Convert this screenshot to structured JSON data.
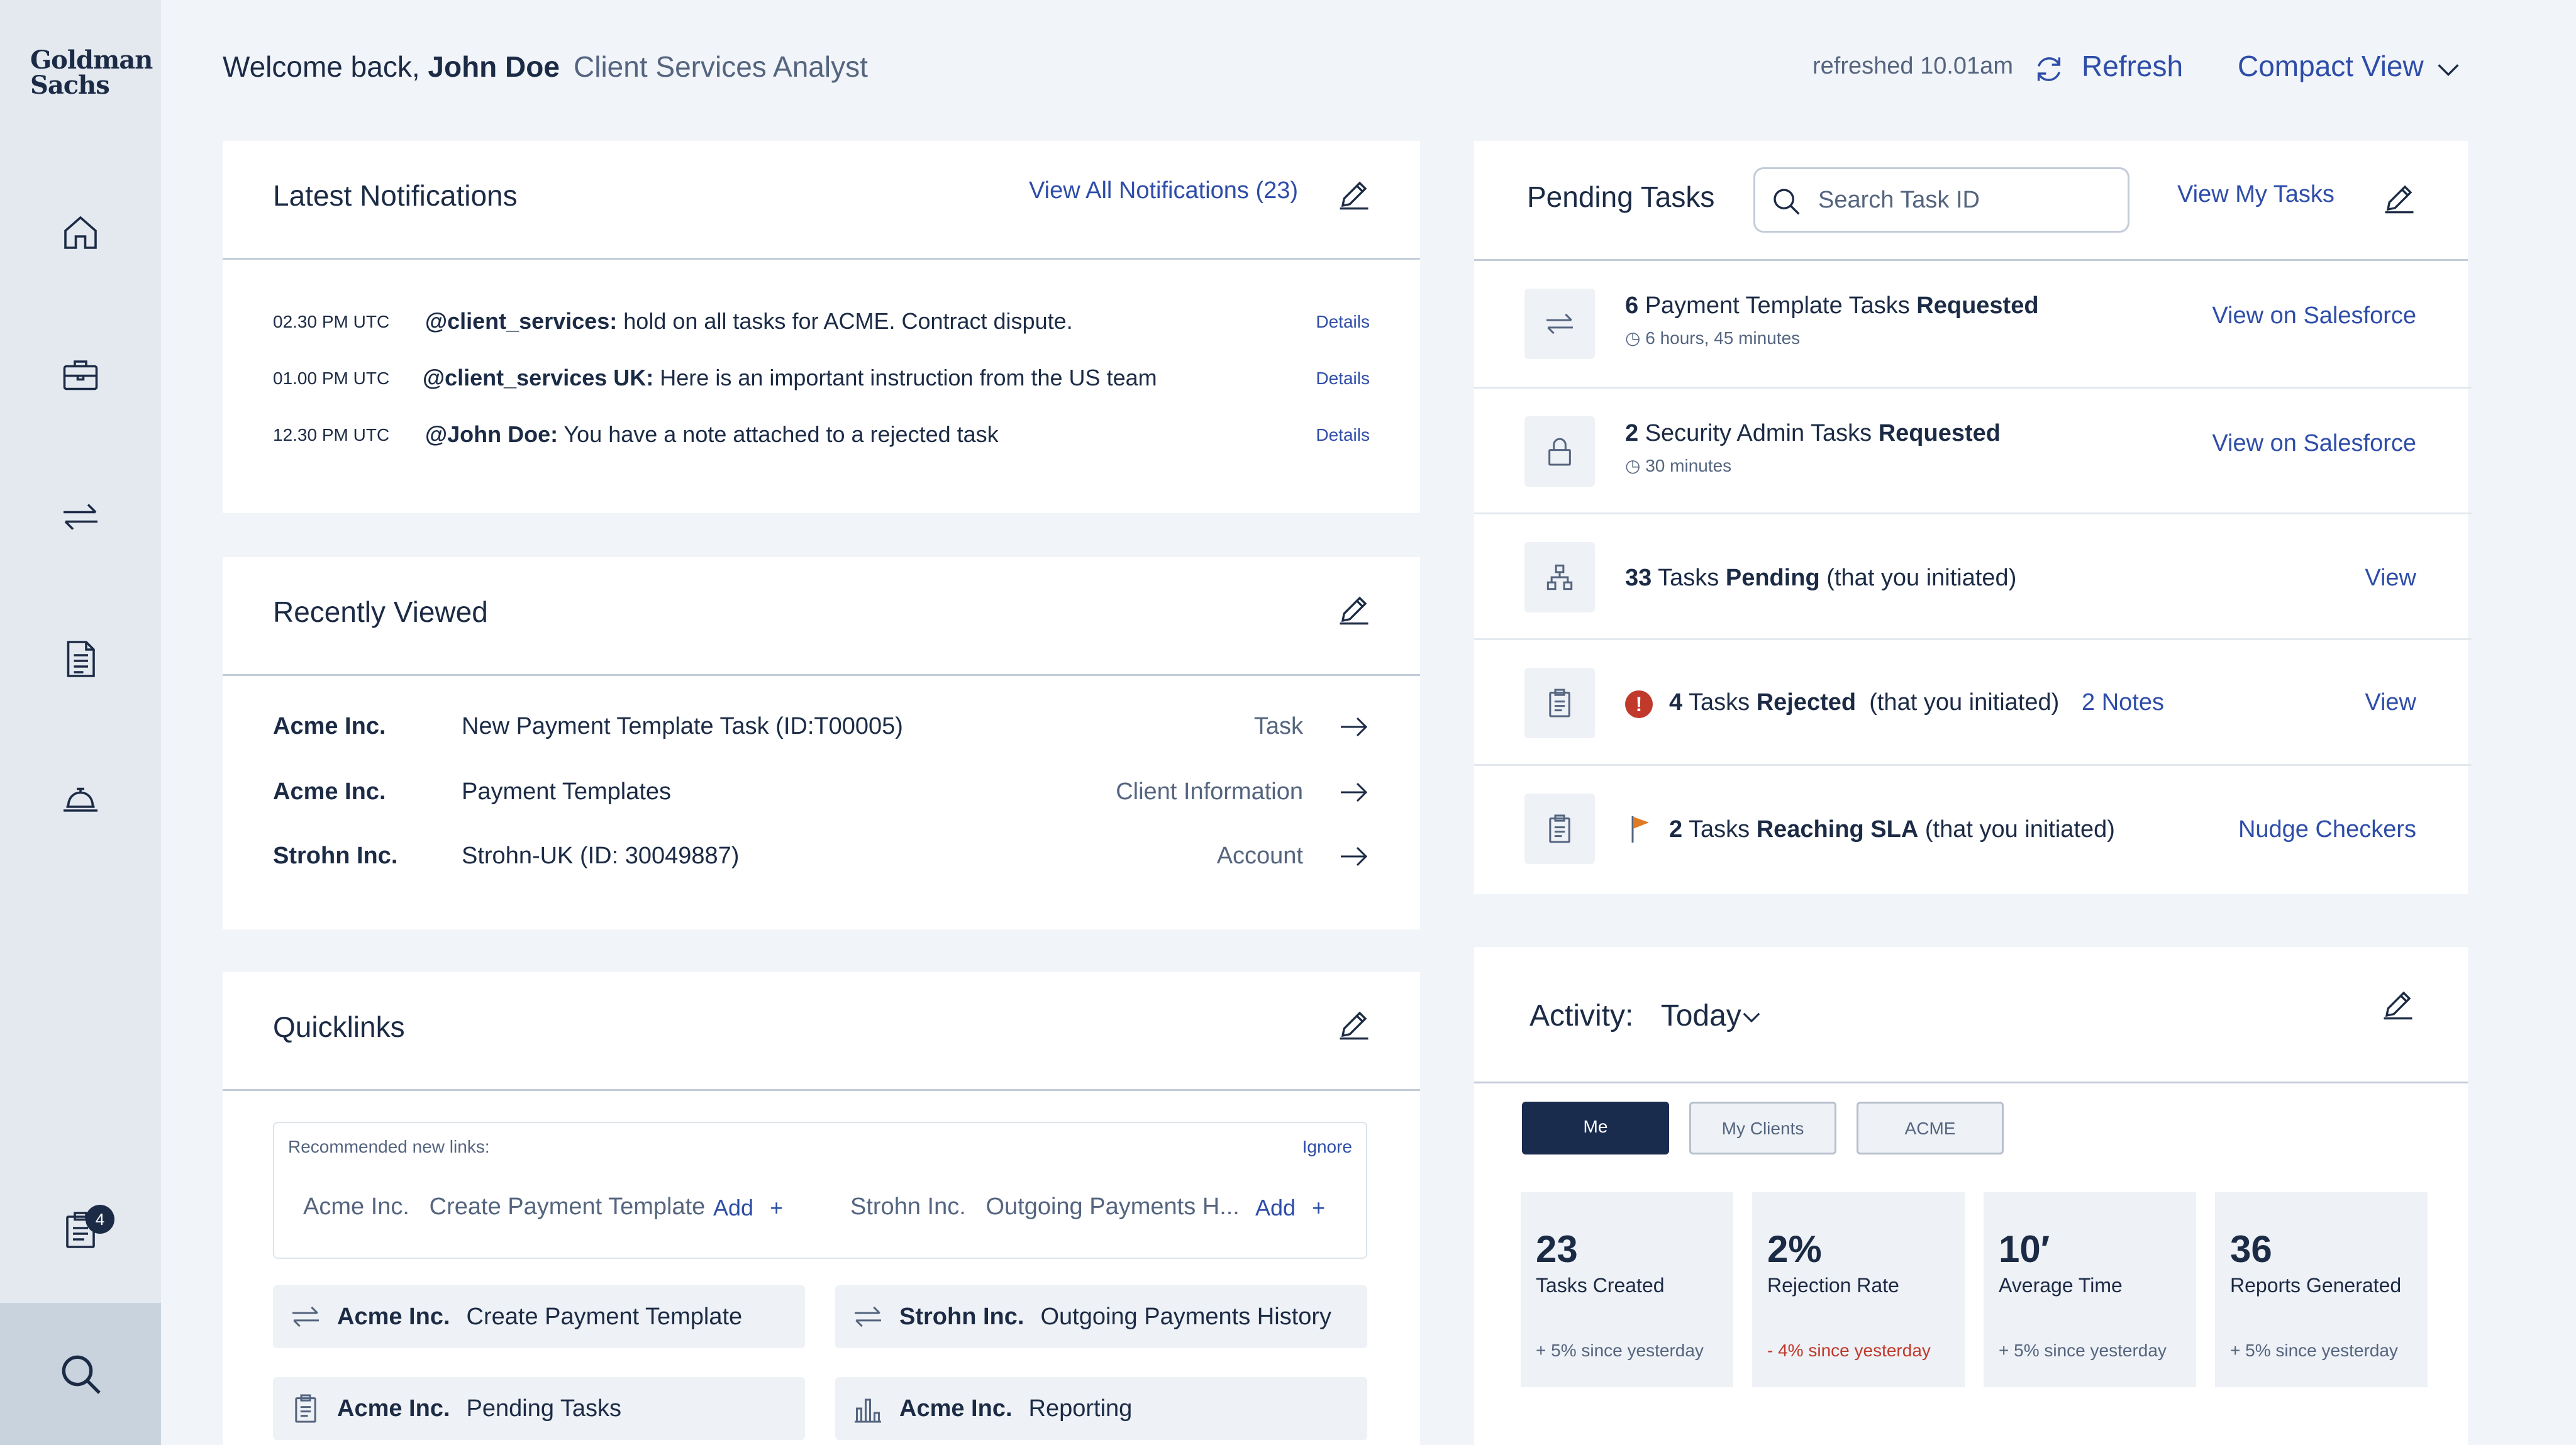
{
  "brand": {
    "logo_line1": "Goldman",
    "logo_line2": "Sachs"
  },
  "sidebar": {
    "items": [
      {
        "icon": "home-icon"
      },
      {
        "icon": "briefcase-icon"
      },
      {
        "icon": "transfer-arrows-icon"
      },
      {
        "icon": "document-icon"
      },
      {
        "icon": "service-bell-icon"
      },
      {
        "icon": "clipboard-icon",
        "badge": "4"
      },
      {
        "icon": "search-icon"
      }
    ]
  },
  "header": {
    "welcome_prefix": "Welcome back,",
    "user_name": "John Doe",
    "role": "Client Services Analyst",
    "refreshed": "refreshed 10.01am",
    "refresh_label": "Refresh",
    "view_label": "Compact View"
  },
  "notifications": {
    "title": "Latest Notifications",
    "view_all": "View All Notifications (23)",
    "items": [
      {
        "time": "02.30 PM UTC",
        "author": "@client_services:",
        "message": " hold on all tasks for ACME. Contract dispute.",
        "details": "Details"
      },
      {
        "time": "01.00 PM UTC",
        "author": "@client_services UK:",
        "message": " Here is an important instruction from the US team",
        "details": "Details"
      },
      {
        "time": "12.30 PM UTC",
        "author": "@John Doe:",
        "message": " You have a note attached to a rejected task",
        "details": "Details"
      }
    ]
  },
  "recently_viewed": {
    "title": "Recently Viewed",
    "items": [
      {
        "client": "Acme Inc.",
        "item": "New Payment Template Task (ID:T00005)",
        "type": "Task"
      },
      {
        "client": "Acme Inc.",
        "item": "Payment Templates",
        "type": "Client Information"
      },
      {
        "client": "Strohn Inc.",
        "item": "Strohn-UK (ID: 30049887)",
        "type": "Account"
      }
    ]
  },
  "quicklinks": {
    "title": "Quicklinks",
    "recommended_label": "Recommended new links:",
    "ignore": "Ignore",
    "recommended": [
      {
        "client": "Acme Inc.",
        "link": "Create Payment Template",
        "add": "Add"
      },
      {
        "client": "Strohn Inc.",
        "link": "Outgoing Payments H...",
        "add": "Add"
      }
    ],
    "links": [
      {
        "client": "Acme Inc.",
        "link": "Create Payment Template",
        "icon": "transfer-arrows-icon"
      },
      {
        "client": "Strohn Inc.",
        "link": "Outgoing Payments History",
        "icon": "transfer-arrows-icon"
      },
      {
        "client": "Acme Inc.",
        "link": "Pending Tasks",
        "icon": "clipboard-icon"
      },
      {
        "client": "Acme Inc.",
        "link": "Reporting",
        "icon": "bar-chart-icon"
      }
    ]
  },
  "pending_tasks": {
    "title": "Pending Tasks",
    "search_placeholder": "Search Task ID",
    "view_my": "View My Tasks",
    "rows": [
      {
        "icon": "transfer-arrows-icon",
        "count": "6",
        "text": " Payment Template Tasks ",
        "bold": "Requested",
        "sub": "6 hours, 45 minutes",
        "action": "View on Salesforce"
      },
      {
        "icon": "lock-icon",
        "count": "2",
        "text": " Security Admin Tasks ",
        "bold": "Requested",
        "sub": "30 minutes",
        "action": "View on Salesforce"
      },
      {
        "icon": "hierarchy-icon",
        "count": "33",
        "text": " Tasks ",
        "bold": "Pending",
        "suffix": " (that you initiated)",
        "action": "View"
      },
      {
        "icon": "clipboard-icon",
        "status_icon": "alert-icon",
        "count": "4",
        "text": " Tasks ",
        "bold": "Rejected",
        "suffix": "  (that you initiated)",
        "notes": "2 Notes",
        "action": "View"
      },
      {
        "icon": "clipboard-icon",
        "status_icon": "flag-icon",
        "count": "2",
        "text": " Tasks ",
        "bold": "Reaching SLA",
        "suffix": " (that you initiated)",
        "action": "Nudge Checkers"
      }
    ]
  },
  "activity": {
    "title": "Activity:",
    "period": "Today",
    "tabs": [
      "Me",
      "My Clients",
      "ACME"
    ],
    "active_tab": "Me",
    "stats": [
      {
        "value": "23",
        "label": "Tasks Created",
        "trend": "+ 5% since yesterday",
        "negative": false
      },
      {
        "value": "2%",
        "label": "Rejection Rate",
        "trend": "- 4% since yesterday",
        "negative": true
      },
      {
        "value": "10′",
        "label": "Average Time",
        "trend": "+ 5% since yesterday",
        "negative": false
      },
      {
        "value": "36",
        "label": "Reports Generated",
        "trend": "+ 5% since yesterday",
        "negative": false
      }
    ]
  },
  "colors": {
    "navy": "#1c2b45",
    "link": "#2e4da8",
    "danger": "#c0392b",
    "flag": "#e07b24"
  }
}
